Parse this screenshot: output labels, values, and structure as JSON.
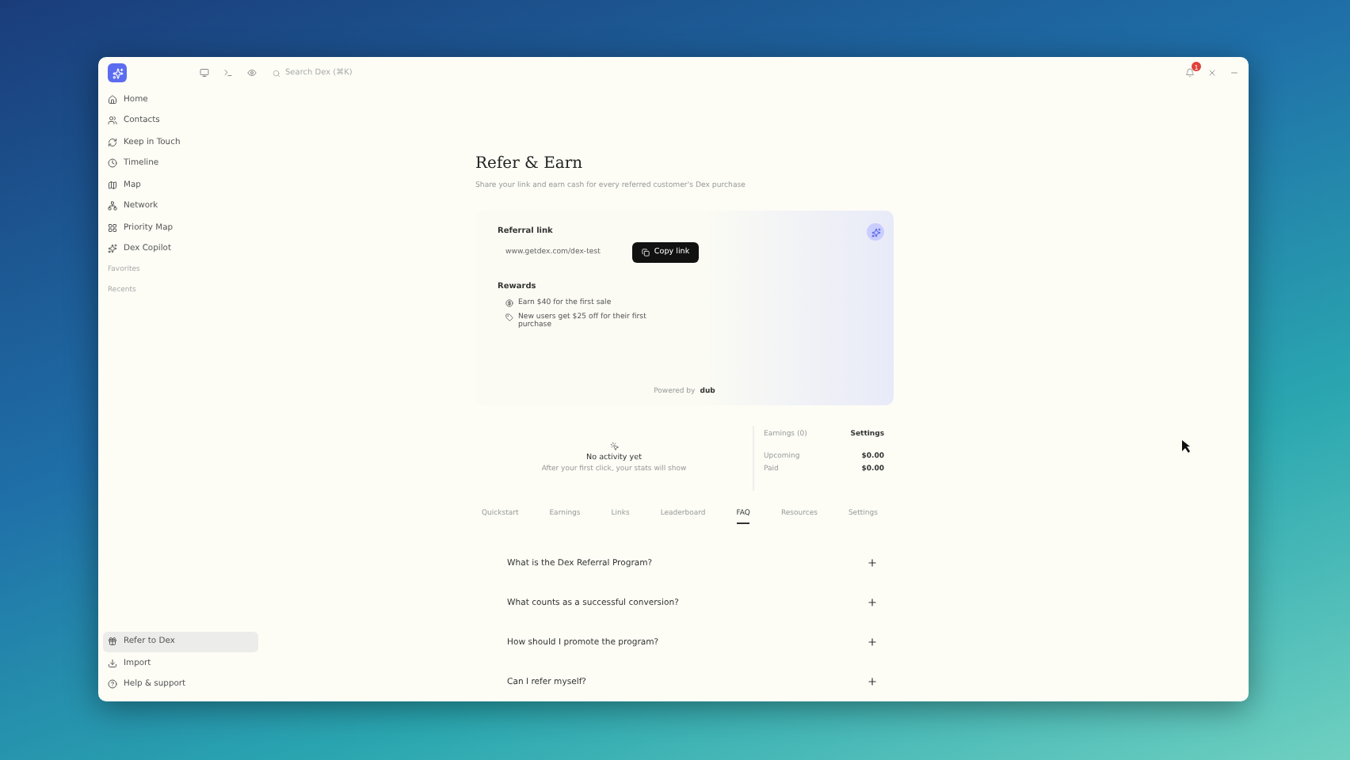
{
  "topbar": {
    "search": {
      "placeholder": "Search Dex (⌘K)"
    },
    "notification_count": "1"
  },
  "sidebar": {
    "items": [
      {
        "label": "Home",
        "selected": false
      },
      {
        "label": "Contacts",
        "selected": false
      },
      {
        "label": "Keep in Touch",
        "selected": false
      },
      {
        "label": "Timeline",
        "selected": false
      },
      {
        "label": "Map",
        "selected": false
      },
      {
        "label": "Network",
        "selected": false
      },
      {
        "label": "Priority Map",
        "selected": false
      },
      {
        "label": "Dex Copilot",
        "selected": false
      }
    ],
    "sections": [
      "Favorites",
      "Recents"
    ],
    "footer_items": [
      {
        "label": "Refer to Dex",
        "selected": true
      },
      {
        "label": "Import",
        "selected": false
      },
      {
        "label": "Help & support",
        "selected": false
      }
    ]
  },
  "page": {
    "title": "Refer & Earn",
    "subtitle": "Share your link and earn cash for every referred customer's Dex purchase"
  },
  "referral": {
    "heading": "Referral link",
    "link": "www.getdex.com/dex-test",
    "copy_button": "Copy link",
    "rewards_heading": "Rewards",
    "rewards": [
      "Earn $40 for the first sale",
      "New users get $25 off for their first purchase"
    ],
    "powered_by": "Powered by",
    "brand": "dub"
  },
  "activity": {
    "title": "No activity yet",
    "text": "After your first click, your stats will show"
  },
  "earnings": {
    "title": "Earnings (0)",
    "settings": "Settings",
    "rows": [
      {
        "label": "Upcoming",
        "value": "$0.00"
      },
      {
        "label": "Paid",
        "value": "$0.00"
      }
    ]
  },
  "tabs": [
    {
      "label": "Quickstart",
      "selected": false
    },
    {
      "label": "Earnings",
      "selected": false
    },
    {
      "label": "Links",
      "selected": false
    },
    {
      "label": "Leaderboard",
      "selected": false
    },
    {
      "label": "FAQ",
      "selected": true
    },
    {
      "label": "Resources",
      "selected": false
    },
    {
      "label": "Settings",
      "selected": false
    }
  ],
  "faq": [
    {
      "question": "What is the Dex Referral Program?",
      "expanded": false
    },
    {
      "question": "What counts as a successful conversion?",
      "expanded": false
    },
    {
      "question": "How should I promote the program?",
      "expanded": false
    },
    {
      "question": "Can I refer myself?",
      "expanded": false
    }
  ]
}
